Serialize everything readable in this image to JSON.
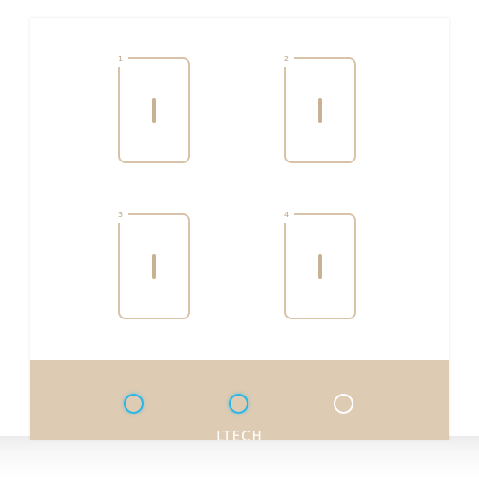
{
  "keys": [
    {
      "number": "1",
      "state": "off"
    },
    {
      "number": "2",
      "state": "off"
    },
    {
      "number": "3",
      "state": "off"
    },
    {
      "number": "4",
      "state": "off"
    }
  ],
  "indicators": [
    {
      "state": "on",
      "color": "#28b5e8"
    },
    {
      "state": "on",
      "color": "#28b5e8"
    },
    {
      "state": "off",
      "color": "#ffffff"
    }
  ],
  "brand": {
    "text": "LTECH"
  },
  "colors": {
    "panel": "#ffffff",
    "band": "#ddcbb3",
    "key_outline": "#d8c3a8",
    "indicator_on": "#28b5e8"
  }
}
